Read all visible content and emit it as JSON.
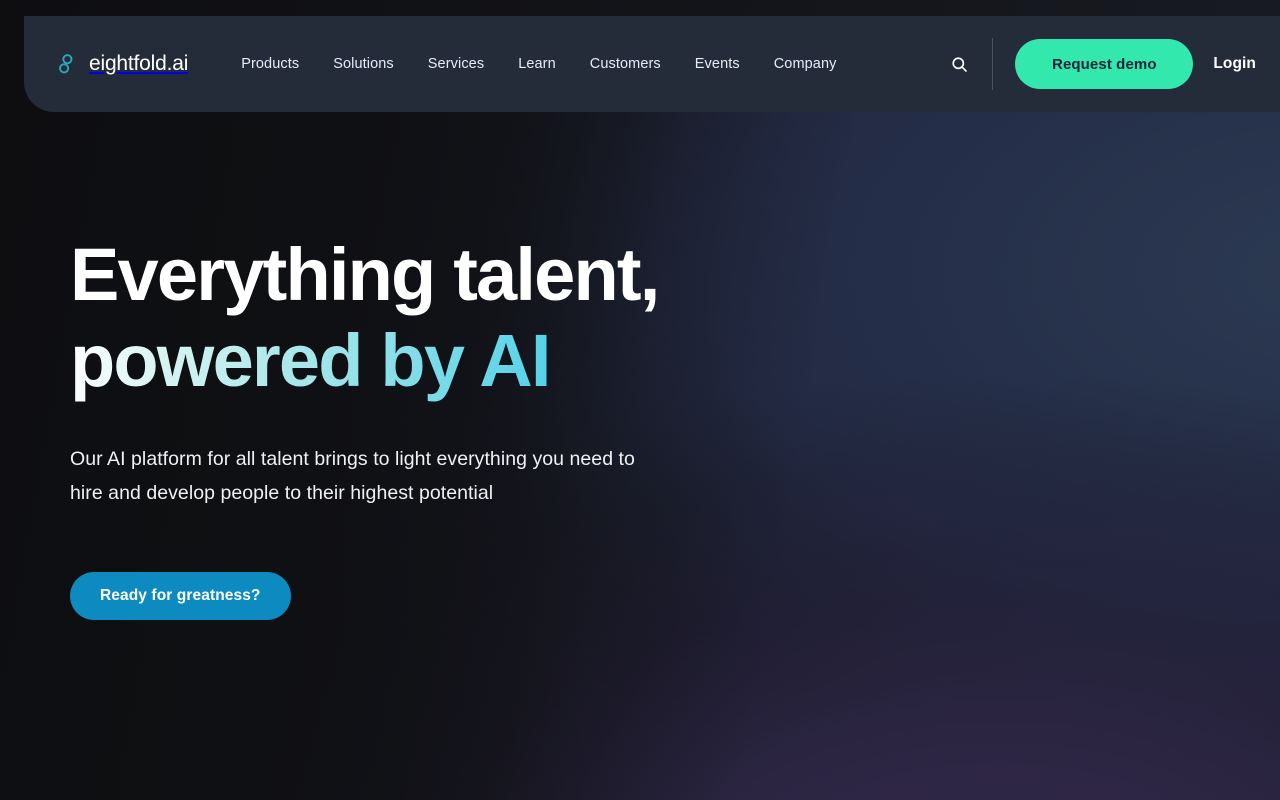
{
  "brand": {
    "name": "eightfold.ai",
    "logo_icon": "infinity-icon",
    "logo_color": "#2aa9b8"
  },
  "header": {
    "background_color": "#242c3a",
    "nav_items": [
      {
        "label": "Products"
      },
      {
        "label": "Solutions"
      },
      {
        "label": "Services"
      },
      {
        "label": "Learn"
      },
      {
        "label": "Customers"
      },
      {
        "label": "Events"
      },
      {
        "label": "Company"
      }
    ],
    "search_icon": "search-icon",
    "request_demo_label": "Request demo",
    "request_demo_color": "#33e8ac",
    "login_label": "Login"
  },
  "hero": {
    "headline_line1": "Everything talent,",
    "headline_line2": "powered by AI",
    "headline_gradient_from": "#ffffff",
    "headline_gradient_to": "#30c6e8",
    "subheadline": "Our AI platform for all talent brings to light everything you need to hire and develop people to their highest potential",
    "cta_label": "Ready for greatness?",
    "cta_color": "#0d8bc1"
  }
}
